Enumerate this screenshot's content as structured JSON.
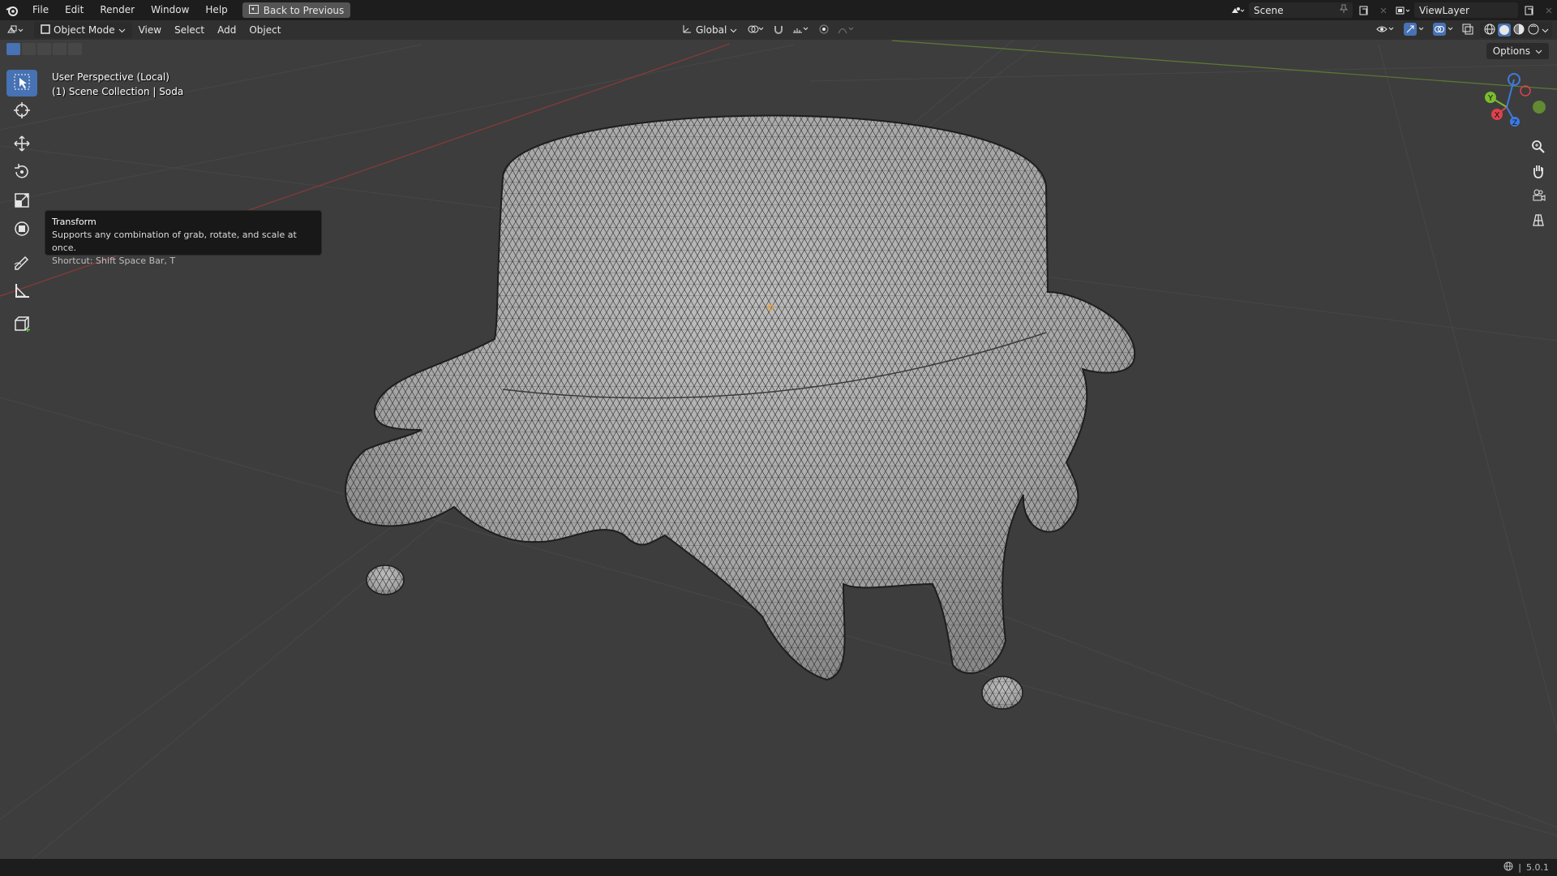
{
  "menubar": {
    "items": [
      "File",
      "Edit",
      "Render",
      "Window",
      "Help"
    ],
    "back_button": "Back to Previous",
    "scene": "Scene",
    "view_layer": "ViewLayer"
  },
  "header": {
    "mode": "Object Mode",
    "menus": [
      "View",
      "Select",
      "Add",
      "Object"
    ],
    "orientation": "Global"
  },
  "viewport": {
    "perspective_label": "User Perspective (Local)",
    "collection_label": "(1) Scene Collection | Soda",
    "options_label": "Options"
  },
  "tooltip": {
    "title": "Transform",
    "description": "Supports any combination of grab, rotate, and scale at once.",
    "shortcut": "Shortcut: Shift Space Bar, T"
  },
  "gizmo": {
    "axes": [
      "X",
      "Y",
      "Z"
    ],
    "colors": {
      "x": "#e0414d",
      "y": "#7bbd2e",
      "z": "#3f7ae0"
    }
  },
  "status": {
    "version": "5.0.1"
  },
  "colors": {
    "accent": "#4772b3",
    "viewport_bg": "#3d3d3d"
  }
}
